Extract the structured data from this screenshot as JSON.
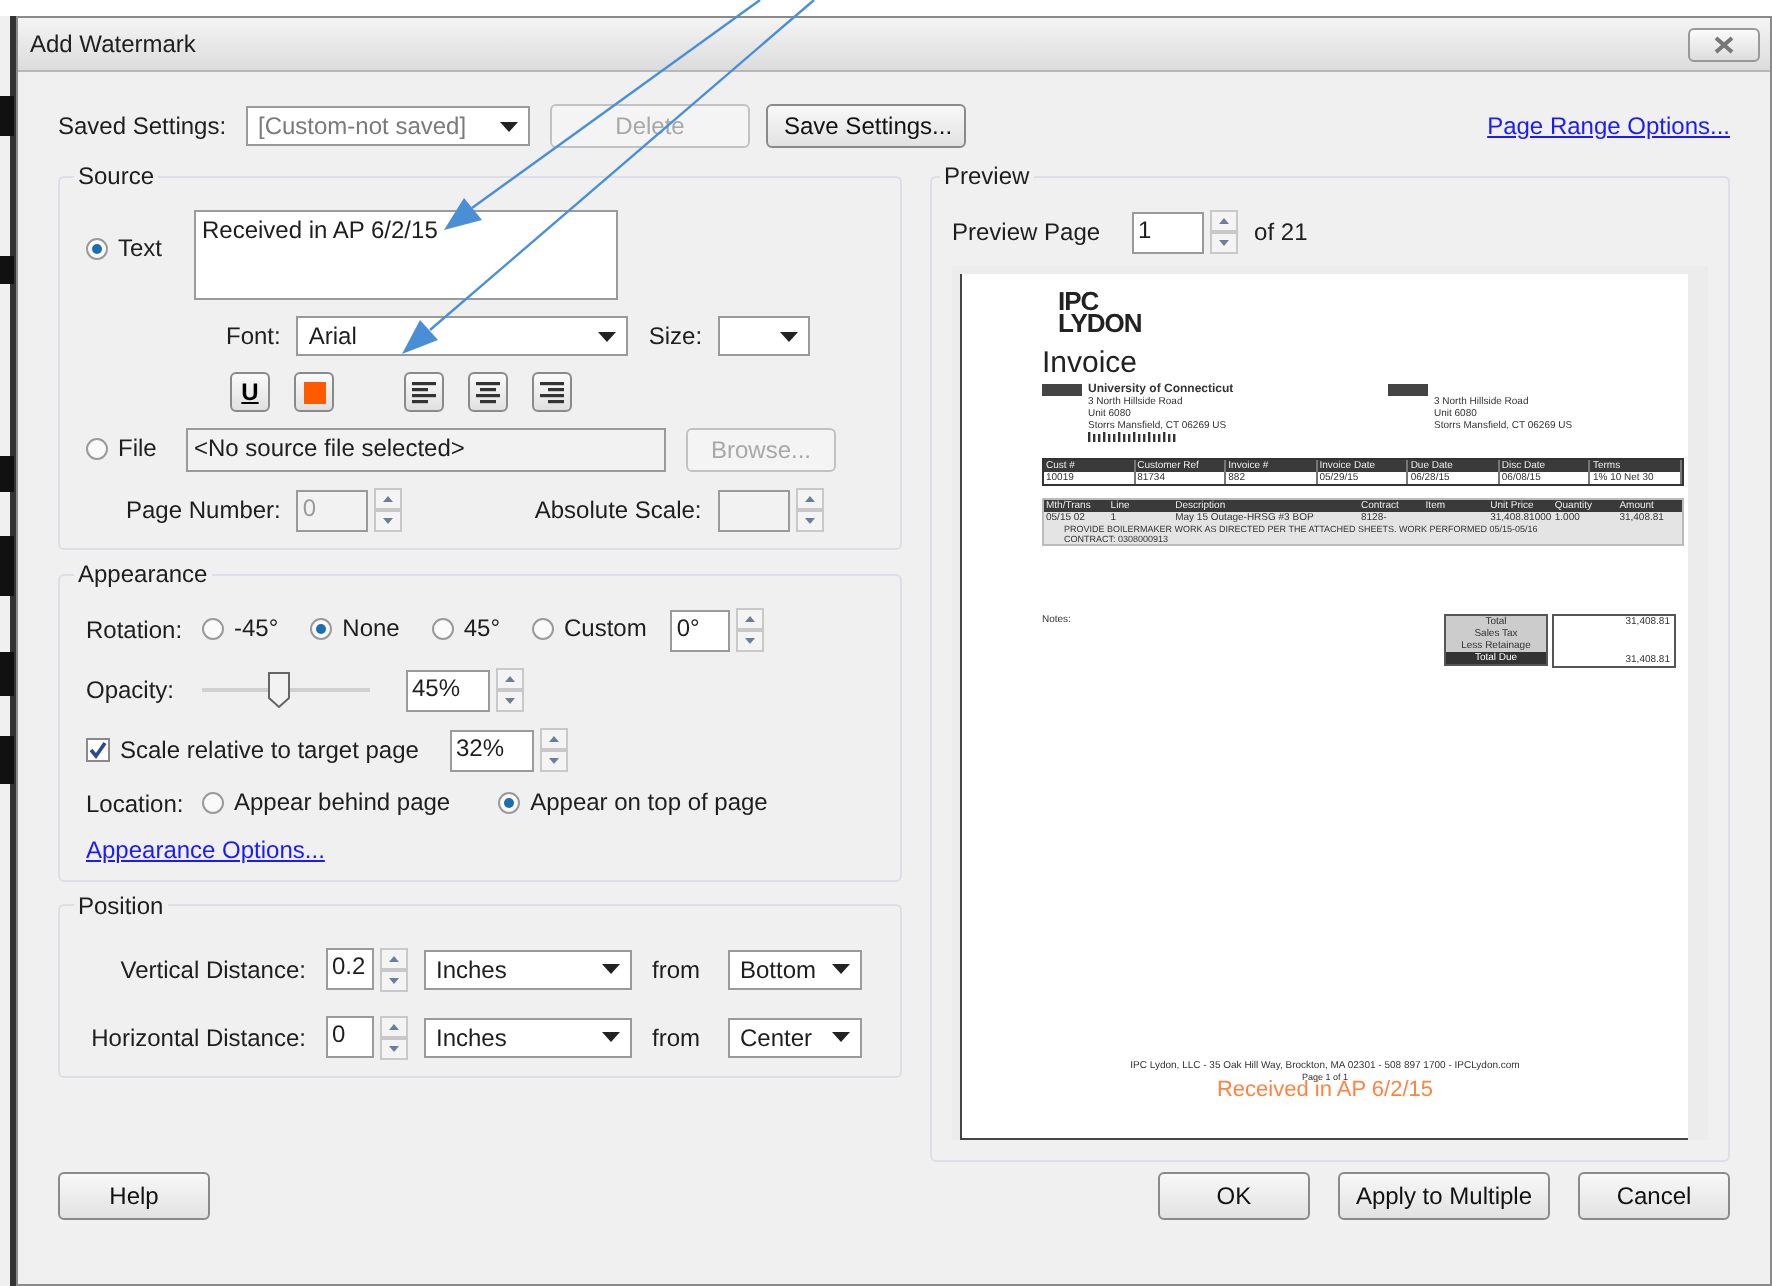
{
  "window": {
    "title": "Add Watermark"
  },
  "saved_settings": {
    "label": "Saved Settings:",
    "value": "[Custom-not saved]",
    "buttons": [
      {
        "label": "Delete",
        "disabled": true
      },
      {
        "label": "Save Settings...",
        "disabled": false
      }
    ]
  },
  "page_range_link": "Page Range Options...",
  "source": {
    "title": "Source",
    "text_option": {
      "label": "Text",
      "selected": true
    },
    "text_value": "Received in AP 6/2/15",
    "font_label": "Font:",
    "font_value": "Arial",
    "size_label": "Size:",
    "format_buttons": [
      {
        "kind": "underline",
        "label": "U"
      },
      {
        "kind": "color",
        "color": "#ff5a00"
      },
      {
        "kind": "align-left"
      },
      {
        "kind": "align-center"
      },
      {
        "kind": "align-right"
      }
    ],
    "file_option": {
      "label": "File",
      "selected": false
    },
    "file_value": "<No source file selected>",
    "browse_button": {
      "label": "Browse...",
      "disabled": true
    },
    "page_number_label": "Page Number:",
    "page_number_value": "0",
    "absolute_scale_label": "Absolute Scale:"
  },
  "appearance": {
    "title": "Appearance",
    "rotation_label": "Rotation:",
    "rotation_options": [
      {
        "label": "-45°",
        "selected": false
      },
      {
        "label": "None",
        "selected": true
      },
      {
        "label": "45°",
        "selected": false
      },
      {
        "label": "Custom",
        "selected": false
      }
    ],
    "custom_value": "0°",
    "opacity_label": "Opacity:",
    "opacity_slider": {
      "level": 0.45
    },
    "opacity_value": "45%",
    "scale": {
      "label": "Scale relative to target page",
      "checked": true,
      "value": "32%"
    },
    "location_label": "Location:",
    "location_options": [
      {
        "label": "Appear behind page",
        "selected": false
      },
      {
        "label": "Appear on top of page",
        "selected": true
      }
    ],
    "options_link": "Appearance Options..."
  },
  "position": {
    "title": "Position",
    "rows": [
      {
        "label": "Vertical Distance:",
        "value": "0.2",
        "unit": "Inches",
        "from_label": "from",
        "from_value": "Bottom"
      },
      {
        "label": "Horizontal Distance:",
        "value": "0",
        "unit": "Inches",
        "from_label": "from",
        "from_value": "Center"
      }
    ]
  },
  "preview": {
    "title": "Preview",
    "page_label": "Preview Page",
    "page_value": "1",
    "of_label": "of 21",
    "document": {
      "logo": [
        "IPC",
        "LYDON"
      ],
      "heading": "Invoice",
      "bill_to": [
        "University of Connecticut",
        "3 North Hillside Road",
        "Unit 6080",
        "Storrs Mansfield, CT  06269  US"
      ],
      "ship_to": [
        "3 North Hillside Road",
        "Unit 6080",
        "Storrs Mansfield, CT  06269 US"
      ],
      "table1": {
        "columns": [
          "Cust #",
          "Customer Ref",
          "Invoice #",
          "Invoice Date",
          "Due Date",
          "Disc Date",
          "Terms"
        ],
        "row": [
          "10019",
          "81734",
          "882",
          "05/29/15",
          "06/28/15",
          "06/08/15",
          "1% 10 Net 30"
        ]
      },
      "table2": {
        "columns": [
          {
            "label": "Mth/Trans",
            "kind": "filled"
          },
          {
            "label": "Line",
            "kind": "filled"
          },
          {
            "label": "Description",
            "kind": "filled"
          },
          {
            "label": "Contract",
            "kind": "filled"
          },
          {
            "label": "Item",
            "kind": "empty"
          },
          {
            "label": "Unit Price",
            "kind": "filled"
          },
          {
            "label": "Quantity",
            "kind": "filled"
          },
          {
            "label": "Amount",
            "kind": "filled"
          }
        ],
        "row": [
          "05/15 02",
          "1",
          "May 15 Outage-HRSG #3 BOP",
          "8128-",
          "31,408.81000",
          "1.000",
          "31,408.81"
        ],
        "notes": [
          "PROVIDE BOILERMAKER WORK AS DIRECTED PER THE ATTACHED SHEETS. WORK PERFORMED 05/15-05/16",
          "CONTRACT: 0308000913"
        ]
      },
      "notes_label": "Notes:",
      "totals_labels": [
        "Total",
        "Sales Tax",
        "Less Retainage",
        "Total Due"
      ],
      "total_values": [
        "31,408.81",
        "31,408.81"
      ],
      "footer": "IPC Lydon, LLC - 35 Oak Hill Way, Brockton, MA 02301 - 508 897 1700 - IPCLydon.com",
      "page_number": "Page 1 of 1",
      "watermark": "Received in AP 6/2/15"
    }
  },
  "buttons": {
    "left": [
      {
        "label": "Help"
      }
    ],
    "right": [
      {
        "label": "OK"
      },
      {
        "label": "Apply to Multiple"
      },
      {
        "label": "Cancel"
      }
    ]
  }
}
